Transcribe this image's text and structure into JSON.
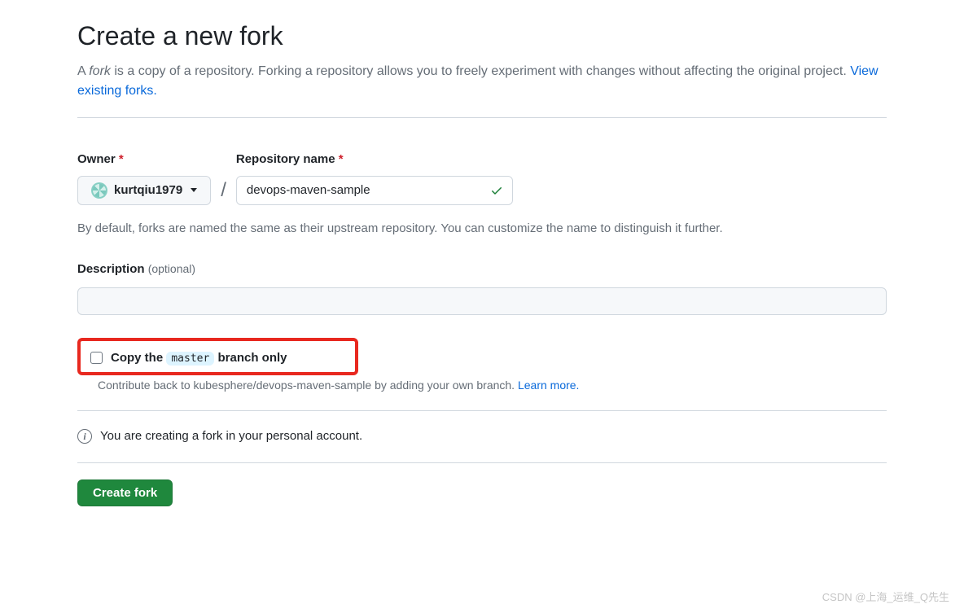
{
  "header": {
    "title": "Create a new fork",
    "subtitle_prefix": "A ",
    "subtitle_em": "fork",
    "subtitle_rest": " is a copy of a repository. Forking a repository allows you to freely experiment with changes without affecting the original project. ",
    "view_forks_link": "View existing forks."
  },
  "form": {
    "owner_label": "Owner",
    "owner_value": "kurtqiu1979",
    "repo_label": "Repository name",
    "repo_value": "devops-maven-sample",
    "repo_help": "By default, forks are named the same as their upstream repository. You can customize the name to distinguish it further.",
    "desc_label": "Description",
    "desc_optional": "(optional)",
    "desc_value": ""
  },
  "checkbox": {
    "prefix": "Copy the ",
    "branch": "master",
    "suffix": " branch only",
    "help_prefix": "Contribute back to kubesphere/devops-maven-sample by adding your own branch. ",
    "learn_more": "Learn more."
  },
  "info": {
    "text": "You are creating a fork in your personal account."
  },
  "actions": {
    "create_button": "Create fork"
  },
  "watermark": "CSDN @上海_运维_Q先生"
}
